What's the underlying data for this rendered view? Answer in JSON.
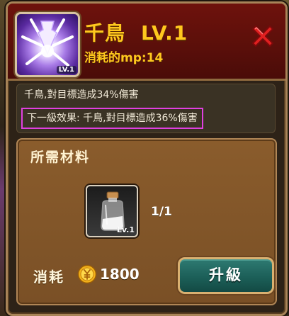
{
  "skill": {
    "name": "千鳥",
    "level": "LV.1",
    "mp_cost": "消耗的mp:14",
    "icon": "lightning-skill-icon",
    "icon_level_tag": "LV.1"
  },
  "effects": {
    "current": "千鳥,對目標造成34%傷害",
    "next": "下一級效果: 千鳥,對目標造成36%傷害"
  },
  "materials": {
    "title": "所需材料",
    "items": [
      {
        "icon": "bottle-icon",
        "level_tag": "Lv.1",
        "count": "1/1"
      }
    ]
  },
  "cost": {
    "label": "消耗",
    "currency_icon": "gold-coin-icon",
    "value": "1800"
  },
  "buttons": {
    "upgrade": "升級",
    "close": "close-icon"
  },
  "colors": {
    "title_gold": "#ffc81e",
    "header_red": "#6e120c",
    "highlight_magenta": "#e040e0",
    "upgrade_teal": "#1c5f58",
    "close_red": "#e02020"
  }
}
